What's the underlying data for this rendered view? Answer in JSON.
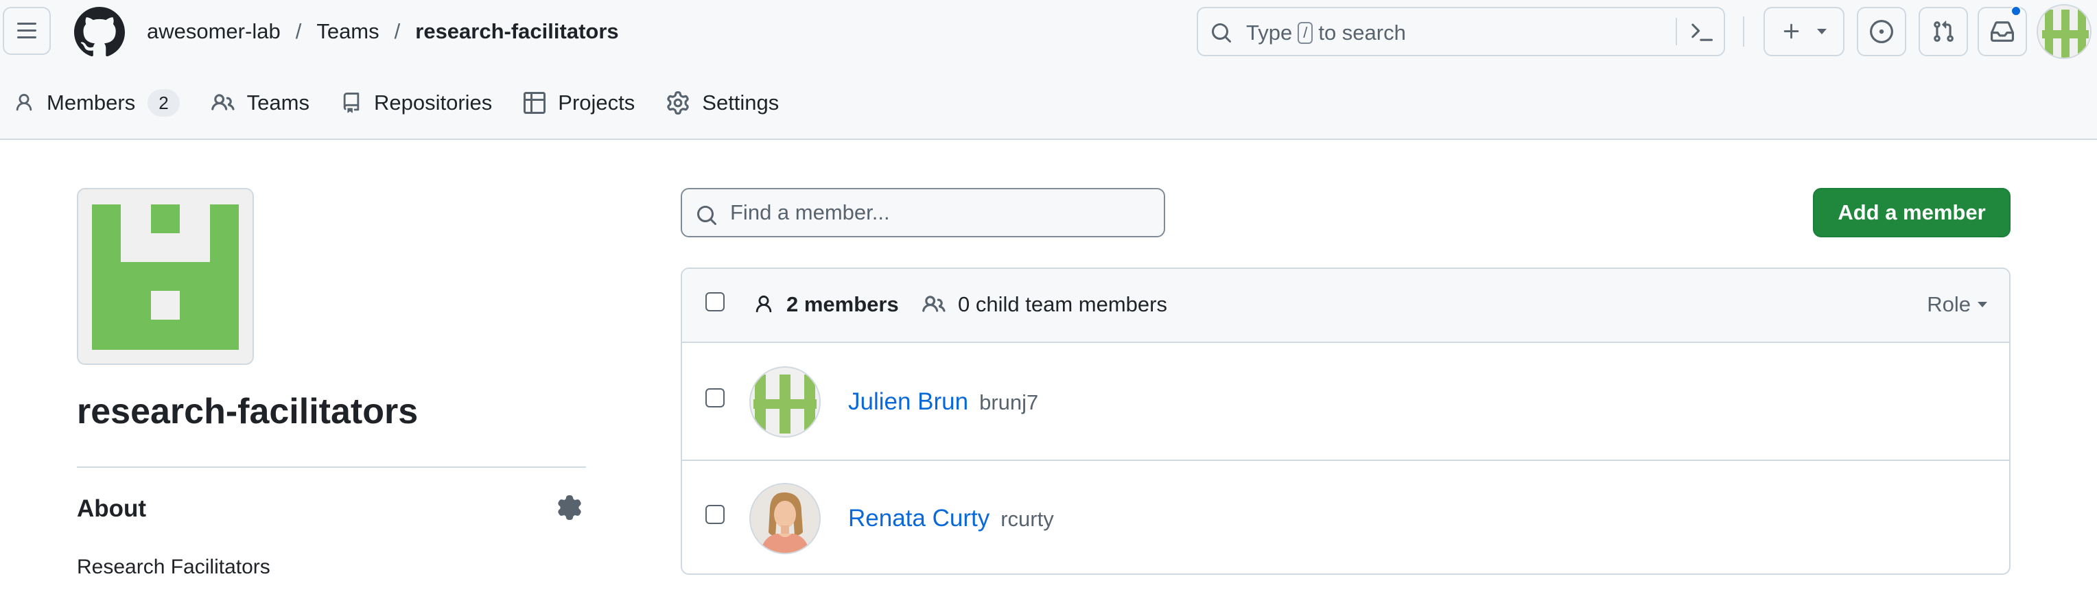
{
  "breadcrumb": {
    "org": "awesomer-lab",
    "separator": "/",
    "teams": "Teams",
    "current": "research-facilitators"
  },
  "search": {
    "prefix": "Type",
    "key": "/",
    "suffix": "to search"
  },
  "tabs": [
    {
      "label": "Members",
      "count": "2",
      "icon": "person-icon"
    },
    {
      "label": "Teams",
      "icon": "people-icon"
    },
    {
      "label": "Repositories",
      "icon": "repo-icon"
    },
    {
      "label": "Projects",
      "icon": "table-icon"
    },
    {
      "label": "Settings",
      "icon": "gear-icon"
    }
  ],
  "team": {
    "name": "research-facilitators",
    "about_title": "About",
    "description": "Research Facilitators"
  },
  "members_panel": {
    "find_placeholder": "Find a member...",
    "add_button": "Add a member",
    "members_count": "2 members",
    "child_count": "0 child team members",
    "role_label": "Role",
    "members": [
      {
        "name": "Julien Brun",
        "login": "brunj7"
      },
      {
        "name": "Renata Curty",
        "login": "rcurty"
      }
    ]
  },
  "colors": {
    "accent": "#0969da",
    "primary_button": "#1f883d",
    "identicon": "#73c05a"
  }
}
